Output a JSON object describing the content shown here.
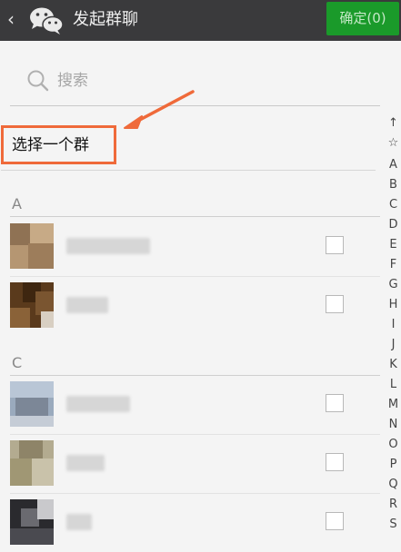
{
  "header": {
    "back_symbol": "‹",
    "title": "发起群聊",
    "confirm_label": "确定(0)"
  },
  "search": {
    "placeholder": "搜索"
  },
  "select_group": {
    "label": "选择一个群"
  },
  "sections": [
    {
      "letter": "A"
    },
    {
      "letter": "C"
    }
  ],
  "index_bar": [
    "↑",
    "☆",
    "A",
    "B",
    "C",
    "D",
    "E",
    "F",
    "G",
    "H",
    "I",
    "J",
    "K",
    "L",
    "M",
    "N",
    "O",
    "P",
    "Q",
    "R",
    "S"
  ],
  "colors": {
    "header_bg": "#3a3a3c",
    "confirm_bg": "#1a9a2a",
    "highlight": "#ef6a3a"
  }
}
